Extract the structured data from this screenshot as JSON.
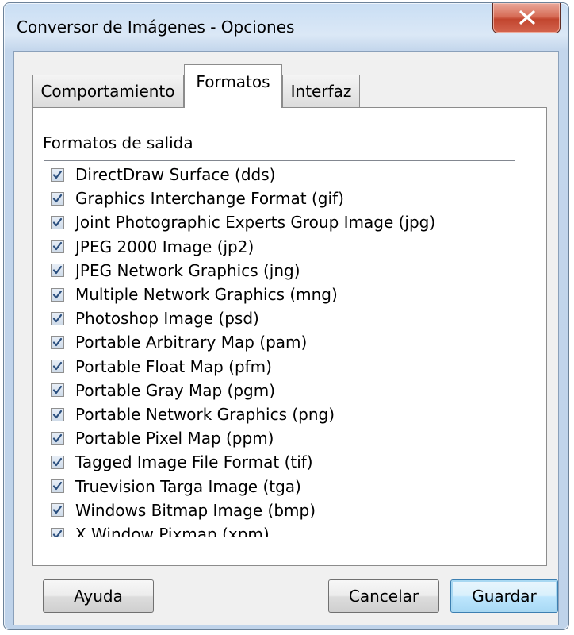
{
  "window": {
    "title": "Conversor de Imágenes - Opciones"
  },
  "tabs": [
    {
      "label": "Comportamiento",
      "active": false
    },
    {
      "label": "Formatos",
      "active": true
    },
    {
      "label": "Interfaz",
      "active": false
    }
  ],
  "formats": {
    "label": "Formatos de salida",
    "items": [
      {
        "label": "DirectDraw Surface (dds)",
        "checked": true
      },
      {
        "label": "Graphics Interchange Format (gif)",
        "checked": true
      },
      {
        "label": "Joint Photographic Experts Group Image (jpg)",
        "checked": true
      },
      {
        "label": "JPEG 2000 Image (jp2)",
        "checked": true
      },
      {
        "label": "JPEG Network Graphics (jng)",
        "checked": true
      },
      {
        "label": "Multiple Network Graphics (mng)",
        "checked": true
      },
      {
        "label": "Photoshop Image (psd)",
        "checked": true
      },
      {
        "label": "Portable Arbitrary Map (pam)",
        "checked": true
      },
      {
        "label": "Portable Float Map (pfm)",
        "checked": true
      },
      {
        "label": "Portable Gray Map (pgm)",
        "checked": true
      },
      {
        "label": "Portable Network Graphics (png)",
        "checked": true
      },
      {
        "label": "Portable Pixel Map (ppm)",
        "checked": true
      },
      {
        "label": "Tagged Image File Format (tif)",
        "checked": true
      },
      {
        "label": "Truevision Targa Image (tga)",
        "checked": true
      },
      {
        "label": "Windows Bitmap Image (bmp)",
        "checked": true
      },
      {
        "label": "X Window Pixmap (xpm)",
        "checked": true
      }
    ]
  },
  "buttons": {
    "help": "Ayuda",
    "cancel": "Cancelar",
    "save": "Guardar"
  },
  "icons": {
    "close": "close-icon",
    "check": "checkmark-icon"
  }
}
